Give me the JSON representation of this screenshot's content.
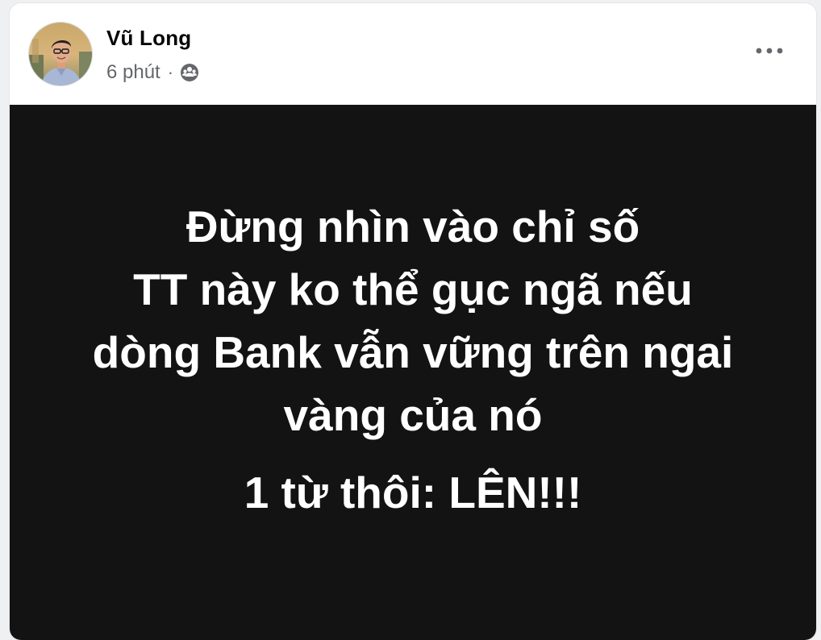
{
  "post": {
    "author": {
      "name": "Vũ Long",
      "avatar_icon": "profile-photo"
    },
    "time": "6 phút",
    "separator": "·",
    "audience_icon": "friends-audience-icon",
    "more_icon": "more-options-icon",
    "background_color": "#131313",
    "text_color": "#ffffff",
    "lines": [
      "Đừng nhìn vào chỉ số",
      "TT này ko thể gục ngã nếu",
      "dòng Bank vẫn vững trên ngai",
      "vàng của nó"
    ],
    "closing_line": "1 từ thôi: LÊN!!!"
  }
}
